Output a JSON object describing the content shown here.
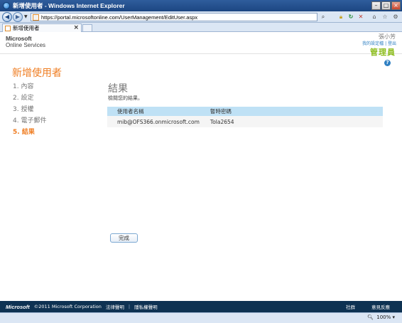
{
  "window": {
    "title": "新增使用者 - Windows Internet Explorer",
    "url": "https://portal.microsoftonline.com/UserManagement/EditUser.aspx",
    "tab_label": "新增使用者",
    "zoom": "100%"
  },
  "header": {
    "logo_line1": "Microsoft",
    "logo_line2": "Online Services",
    "user_name": "張小芳",
    "links": "我的設定檔 | 登出",
    "role": "管理員"
  },
  "page": {
    "title": "新增使用者",
    "steps": [
      "1.  內容",
      "2.  設定",
      "3.  授權",
      "4.  電子郵件",
      "5.  結果"
    ],
    "active_step": 4
  },
  "result": {
    "heading": "結果",
    "description": "檢閱您的結果。",
    "columns": [
      "使用者名稱",
      "暫時密碼"
    ],
    "rows": [
      {
        "username": "mib@OFS366.onmicrosoft.com",
        "password": "Tola2654"
      }
    ],
    "done_label": "完成"
  },
  "footer": {
    "logo": "Microsoft",
    "copyright": "©2011 Microsoft Corporation",
    "legal": "法律聲明",
    "privacy": "隱私權聲明",
    "community": "社群",
    "feedback": "意見反應"
  },
  "colors": {
    "accent": "#ef7d22",
    "role": "#8dbd1f",
    "table_header": "#bfe1f5",
    "footer_bg": "#0e3252"
  }
}
